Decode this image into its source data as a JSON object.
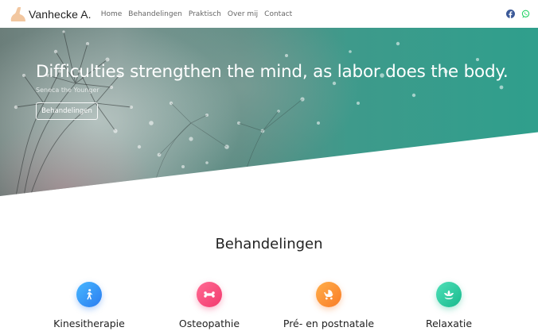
{
  "brand": {
    "name": "Vanhecke A.",
    "logo_icon": "foot-logo-icon"
  },
  "nav": {
    "items": [
      {
        "label": "Home"
      },
      {
        "label": "Behandelingen"
      },
      {
        "label": "Praktisch"
      },
      {
        "label": "Over mij"
      },
      {
        "label": "Contact"
      }
    ]
  },
  "socials": [
    {
      "icon": "facebook-icon",
      "color": "#3b5998"
    },
    {
      "icon": "whatsapp-icon",
      "color": "#25d366"
    }
  ],
  "hero": {
    "quote": "Difficulties strengthen the mind, as labor does the body.",
    "author": "Seneca the Younger",
    "button_label": "Behandelingen"
  },
  "section": {
    "title": "Behandelingen",
    "services": [
      {
        "label": "Kinesitherapie",
        "icon": "walking-person-icon",
        "color": "#2b7cf0"
      },
      {
        "label": "Osteopathie",
        "icon": "bone-icon",
        "color": "#f23a6e"
      },
      {
        "label": "Pré- en postnatale",
        "icon": "baby-carriage-icon",
        "color": "#f97c27"
      },
      {
        "label": "Relaxatie",
        "icon": "lotus-icon",
        "color": "#18b98d"
      }
    ]
  }
}
